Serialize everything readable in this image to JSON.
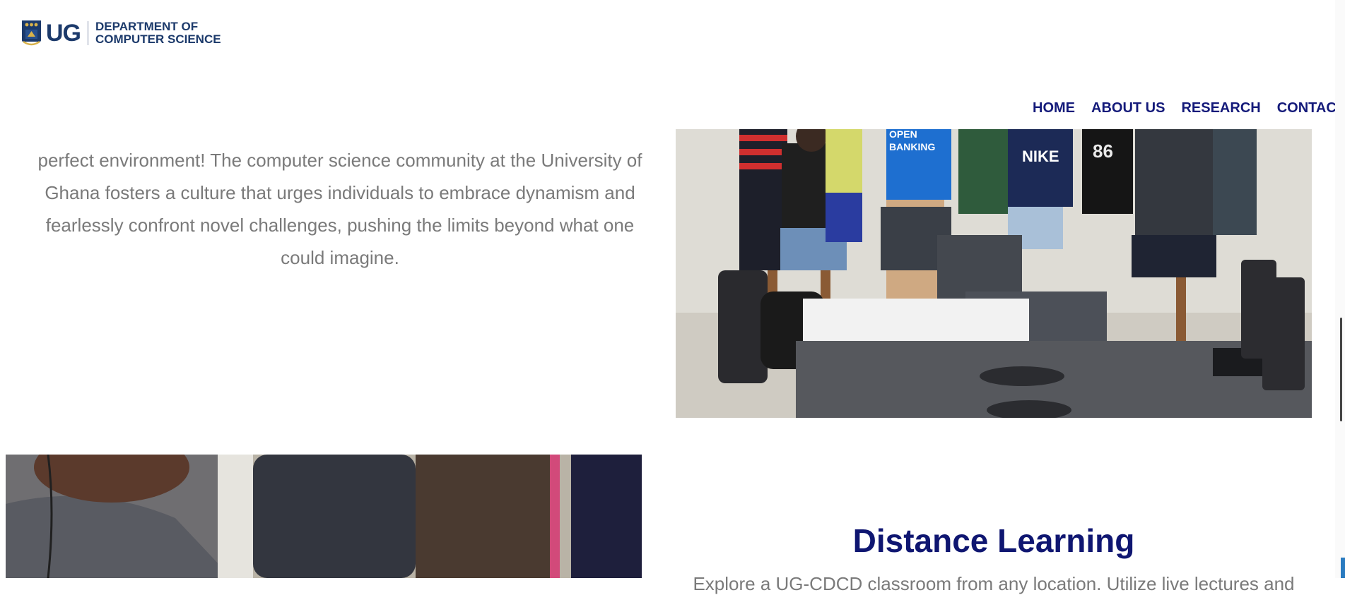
{
  "header": {
    "logo_abbrev": "UG",
    "logo_line1": "DEPARTMENT OF",
    "logo_line2": "COMPUTER SCIENCE",
    "nav": [
      "HOME",
      "ABOUT US",
      "RESEARCH",
      "CONTACT"
    ]
  },
  "intro": {
    "text": "perfect environment! The computer science community at the University of Ghana fosters a culture that urges individuals to embrace dynamism and fearlessly confront novel challenges, pushing the limits beyond what one could imagine."
  },
  "distance_learning": {
    "title": "Distance Learning",
    "text": "Explore a UG-CDCD classroom from any location. Utilize live lectures and"
  },
  "photo1": {
    "shirt_text": "OPEN BANKING",
    "jersey": "86"
  },
  "colors": {
    "brand_navy": "#1c3a6b",
    "nav_blue": "#141a7a",
    "heading": "#0f1671",
    "body_text": "#7a7a7a"
  },
  "icons": [
    "university-crest-icon"
  ]
}
